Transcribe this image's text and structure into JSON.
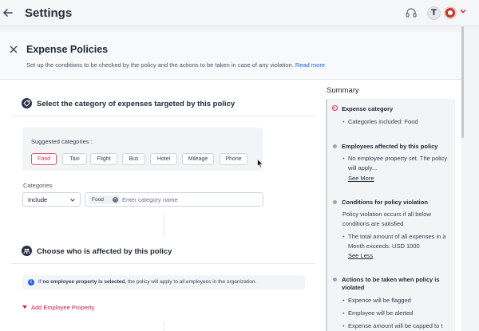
{
  "header": {
    "title": "Settings",
    "avatar_initial": "T"
  },
  "panel": {
    "title": "Expense Policies",
    "description": "Set up the conditions to be checked by the policy and the actions to be taken in case of any violation.",
    "read_more": "Read more"
  },
  "category_section": {
    "title": "Select the category of expenses targeted by this policy",
    "suggested_label": "Suggested categories :",
    "suggested": [
      "Food",
      "Taxi",
      "Flight",
      "Bus",
      "Hotel",
      "Mileage",
      "Phone"
    ],
    "selected": "Food",
    "categories_label": "Categories",
    "include_value": "Include",
    "selected_tag": "Food",
    "input_placeholder": "Enter category name"
  },
  "employee_section": {
    "title": "Choose who is affected by this policy",
    "info_prefix": "If ",
    "info_bold": "no employee property is selected",
    "info_suffix": ", the policy will apply to all employees in the organization.",
    "add_property": "Add Employee Property"
  },
  "summary": {
    "title": "Summary",
    "expense_category": {
      "heading": "Expense category",
      "item": "Categories included: Food"
    },
    "employees": {
      "heading": "Employees affected by this policy",
      "item": "No employee property set. The policy will apply...",
      "link": "See More"
    },
    "conditions": {
      "heading": "Conditions for policy violation",
      "text": "Policy violation occurs if all below conditions are satisfied",
      "item": "The total amount of all expenses in a Month exceeds: USD 1000",
      "link": "See Less"
    },
    "actions": {
      "heading": "Actions to be taken when policy is violated",
      "items": [
        "Expense will be flagged",
        "Employee will be alerted",
        "Expense amount will be capped to t"
      ]
    }
  },
  "colors": {
    "accent": "#d7294a",
    "link": "#2563eb",
    "summary_bg": "#f3f4f6"
  }
}
